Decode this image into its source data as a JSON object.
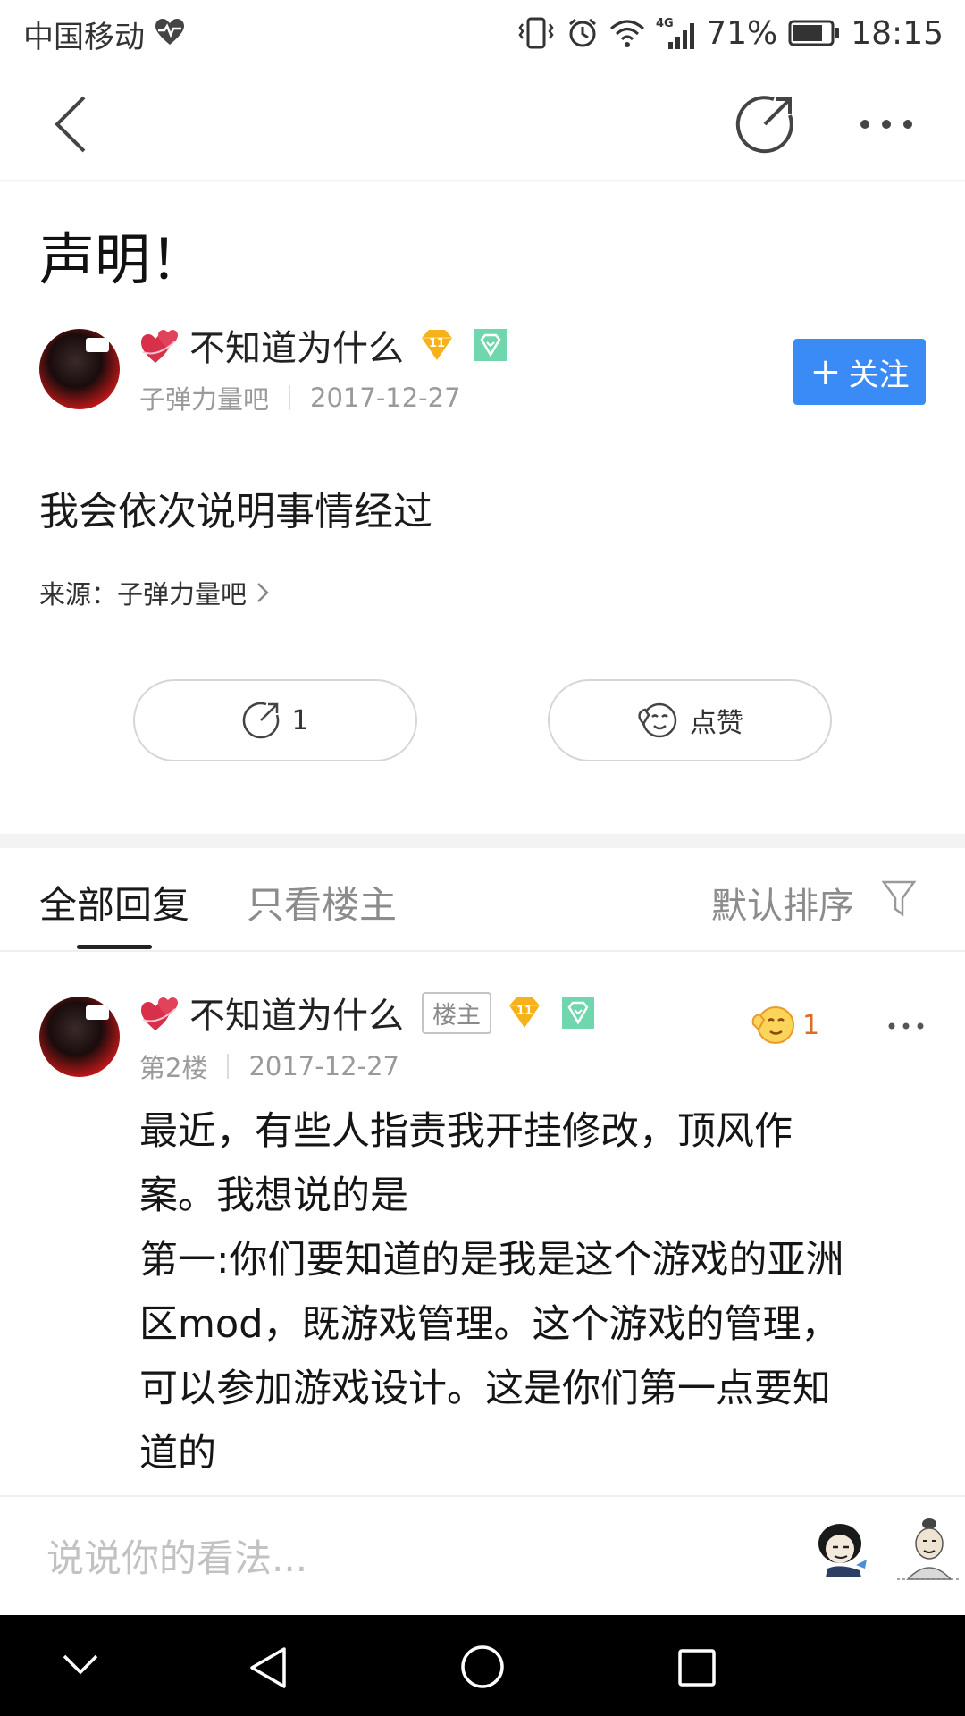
{
  "status_bar": {
    "carrier": "中国移动",
    "network": "4G",
    "battery": "71%",
    "time": "18:15"
  },
  "nav": {
    "back_icon": "chevron-left-icon",
    "share_icon": "share-arrow-icon",
    "more_icon": "ellipsis-icon"
  },
  "post": {
    "title": "声明！",
    "author": {
      "name": "不知道为什么",
      "level": "11",
      "forum": "子弹力量吧",
      "date": "2017-12-27"
    },
    "follow_label": "关注",
    "body": "我会依次说明事情经过",
    "source_label": "来源：",
    "source_name": "子弹力量吧",
    "share_count": "1",
    "like_label": "点赞"
  },
  "tabs": {
    "all_replies": "全部回复",
    "owner_only": "只看楼主",
    "sort": "默认排序"
  },
  "reply": {
    "author": "不知道为什么",
    "owner_tag": "楼主",
    "level": "11",
    "floor": "第2楼",
    "date": "2017-12-27",
    "like_count": "1",
    "lines": [
      "最近，有些人指责我开挂修改，顶风作",
      "案。我想说的是",
      "第一:你们要知道的是我是这个游戏的亚洲",
      "区mod，既游戏管理。这个游戏的管理，",
      "可以参加游戏设计。这是你们第一点要知",
      "道的"
    ]
  },
  "comment_bar": {
    "placeholder": "说说你的看法..."
  },
  "colors": {
    "accent": "#3a8bf5",
    "like_orange": "#e06b28"
  }
}
